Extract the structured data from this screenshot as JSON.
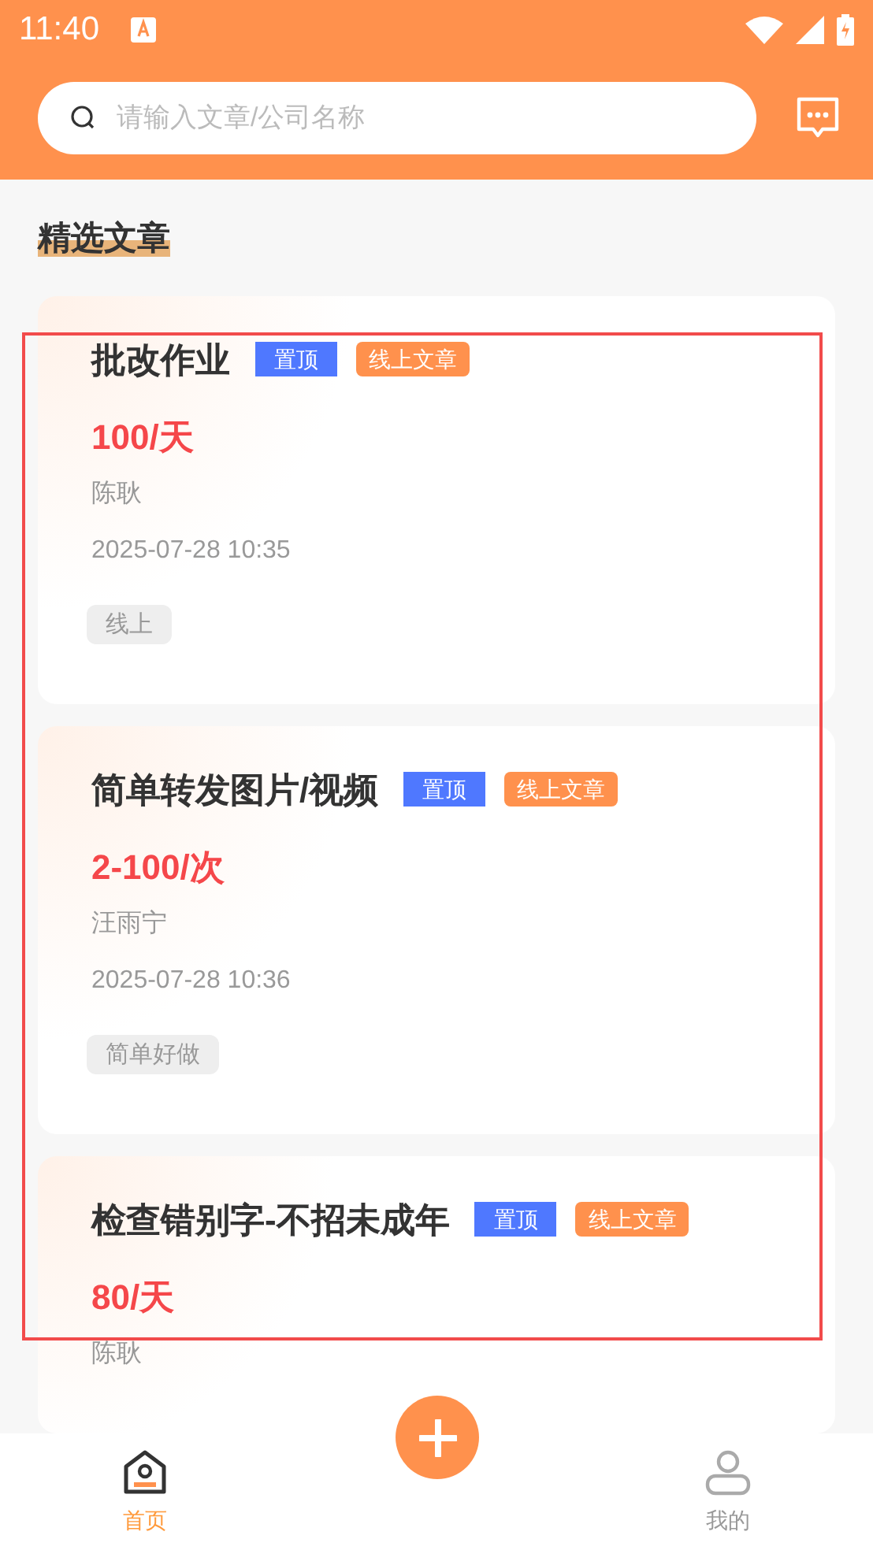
{
  "status_bar": {
    "time": "11:40"
  },
  "search": {
    "placeholder": "请输入文章/公司名称"
  },
  "section_title": "精选文章",
  "articles": [
    {
      "title": "批改作业",
      "pinned_badge": "置顶",
      "type_badge": "线上文章",
      "price": "100/天",
      "author": "陈耿",
      "date": "2025-07-28 10:35",
      "tag": "线上"
    },
    {
      "title": "简单转发图片/视频",
      "pinned_badge": "置顶",
      "type_badge": "线上文章",
      "price": "2-100/次",
      "author": "汪雨宁",
      "date": "2025-07-28 10:36",
      "tag": "简单好做"
    },
    {
      "title": "检查错别字-不招未成年",
      "pinned_badge": "置顶",
      "type_badge": "线上文章",
      "price": "80/天",
      "author": "陈耿"
    }
  ],
  "bottom_nav": [
    {
      "label": "首页",
      "selected": true,
      "kind": "home"
    },
    {
      "label": "我的",
      "selected": false,
      "kind": "profile"
    }
  ]
}
